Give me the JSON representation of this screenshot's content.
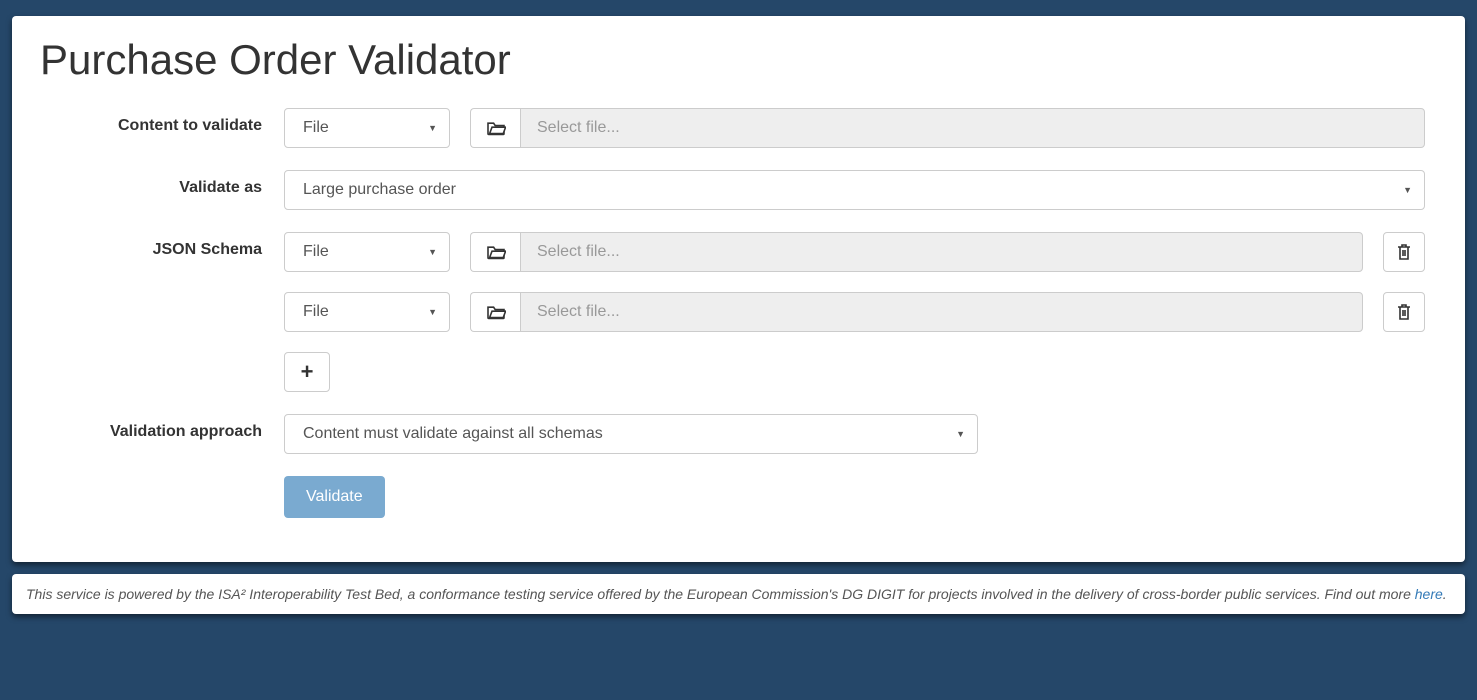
{
  "title": "Purchase Order Validator",
  "labels": {
    "content": "Content to validate",
    "validate_as": "Validate as",
    "json_schema": "JSON Schema",
    "approach": "Validation approach"
  },
  "selects": {
    "content_type": "File",
    "validate_as": "Large purchase order",
    "schema_type1": "File",
    "schema_type2": "File",
    "approach": "Content must validate against all schemas"
  },
  "placeholders": {
    "file": "Select file..."
  },
  "buttons": {
    "validate": "Validate",
    "add": "+"
  },
  "footer": {
    "text": "This service is powered by the ISA² Interoperability Test Bed, a conformance testing service offered by the European Commission's DG DIGIT for projects involved in the delivery of cross-border public services. Find out more ",
    "link": "here",
    "dot": "."
  }
}
